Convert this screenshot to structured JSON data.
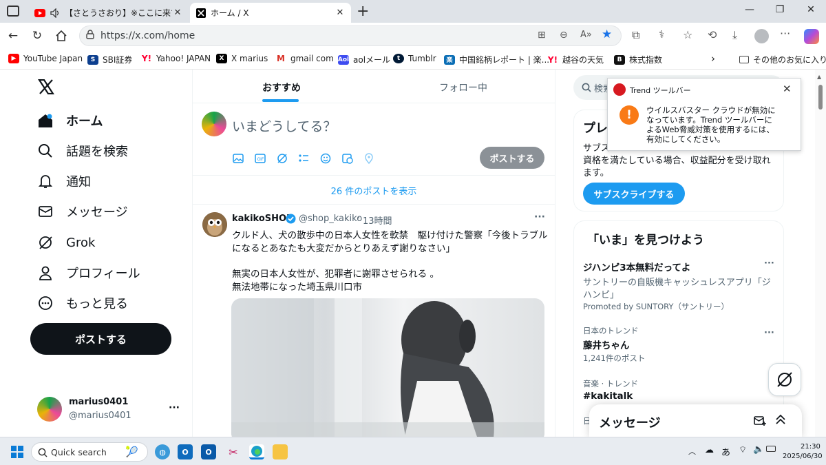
{
  "browser": {
    "tabs": [
      {
        "title": "【さとうさおり】※ここに来て衝撃の",
        "audio": true
      },
      {
        "title": "ホーム / X",
        "active": true
      }
    ],
    "new_tab": "+",
    "window_controls": {
      "minimize": "—",
      "maximize": "❐",
      "close": "✕"
    },
    "url": "https://x.com/home",
    "bookmarks": [
      {
        "label": "YouTube Japan",
        "icon": "youtube-icon"
      },
      {
        "label": "SBI証券",
        "icon": "sbi-icon"
      },
      {
        "label": "Yahoo! JAPAN",
        "icon": "yahoo-icon"
      },
      {
        "label": "X marius",
        "icon": "x-icon"
      },
      {
        "label": "gmail com",
        "icon": "gmail-icon"
      },
      {
        "label": "aolメール",
        "icon": "aol-icon"
      },
      {
        "label": "Tumblr",
        "icon": "tumblr-icon"
      },
      {
        "label": "中国銘柄レポート | 楽...",
        "icon": "rakuten-icon"
      },
      {
        "label": "越谷の天気",
        "icon": "yahoo-icon"
      },
      {
        "label": "株式指数",
        "icon": "b-icon"
      }
    ],
    "bookmarks_more": "その他のお気に入り"
  },
  "sidebar": {
    "nav": [
      {
        "label": "ホーム",
        "icon": "home-icon",
        "bold": true
      },
      {
        "label": "話題を検索",
        "icon": "search-icon"
      },
      {
        "label": "通知",
        "icon": "bell-icon"
      },
      {
        "label": "メッセージ",
        "icon": "mail-icon"
      },
      {
        "label": "Grok",
        "icon": "grok-icon"
      },
      {
        "label": "プロフィール",
        "icon": "person-icon"
      },
      {
        "label": "もっと見る",
        "icon": "more-circle-icon"
      }
    ],
    "post_button": "ポストする",
    "account": {
      "name": "marius0401",
      "handle": "@marius0401",
      "more": "···"
    }
  },
  "feed": {
    "tabs": [
      "おすすめ",
      "フォロー中"
    ],
    "compose_placeholder": "いまどうしてる？",
    "compose_button": "ポストする",
    "show_new_posts": "26 件のポストを表示",
    "post": {
      "author": "kakikoSHOP",
      "handle": "@shop_kakiko",
      "time": "13時間",
      "more": "···",
      "text_line1": "クルド人、犬の散歩中の日本人女性を軟禁　駆け付けた警察「今後トラブル",
      "text_line2": "になるとあなたも大変だからとりあえず謝りなさい」",
      "text_line3": "無実の日本人女性が、犯罪者に謝罪させられる 。",
      "text_line4": "無法地帯になった埼玉県川口市"
    }
  },
  "right": {
    "search_placeholder": "検索",
    "premium": {
      "title": "プレ",
      "body_line1": "サブス",
      "body_line2": "資格を満たしている場合、収益配分を受け取れ",
      "body_line3": "ます。",
      "button": "サブスクライブする"
    },
    "trends": {
      "title": "「いま」を見つけよう",
      "items": [
        {
          "name": "ジハンピ3本無料だってよ",
          "sub_line1": "サントリーの自販機キャッシュレスアプリ「ジ",
          "sub_line2": "ハンピ」",
          "meta": "Promoted by SUNTORY（サントリー）"
        },
        {
          "context": "日本のトレンド",
          "name": "藤井ちゃん",
          "meta": "1,241件のポスト"
        },
        {
          "context": "音楽 · トレンド",
          "name": "#kakitalk"
        },
        {
          "context": "日"
        }
      ],
      "more": "···"
    },
    "messages_drawer": "メッセージ"
  },
  "trend_popup": {
    "title": "Trend ツールバー",
    "body_line1": "ウイルスバスター クラウドが無効に",
    "body_line2": "なっています。Trend ツールバーに",
    "body_line3": "よるWeb脅威対策を使用するには、",
    "body_line4": "有効にしてください。",
    "alert_icon": "!"
  },
  "taskbar": {
    "search_placeholder": "Quick search",
    "time": "21:30",
    "date": "2025/06/30",
    "ime": "あ"
  },
  "colors": {
    "x_blue": "#1d9bf0",
    "tab_strip": "#dfe3e8",
    "taskbar": "#e8ecf1",
    "alert_orange": "#f97a16",
    "text_secondary": "#536471"
  }
}
